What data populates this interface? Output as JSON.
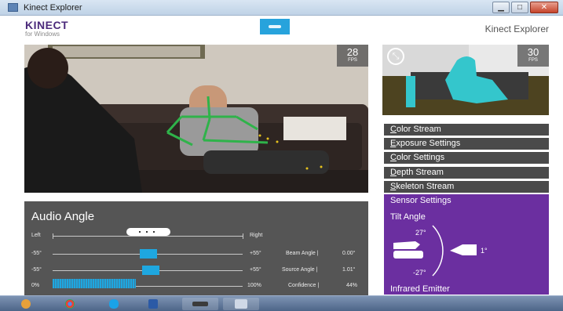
{
  "window": {
    "title": "Kinect Explorer",
    "min_glyph": "▁",
    "max_glyph": "□",
    "close_glyph": "✕"
  },
  "header": {
    "logo_main": "KINECT",
    "logo_sub": "for Windows",
    "app_title": "Kinect Explorer",
    "center_icon": "kinect-sensor-icon"
  },
  "color_stream": {
    "fps": "28",
    "fps_unit": "FPS"
  },
  "depth_stream": {
    "fps": "30",
    "fps_unit": "FPS",
    "icon": "expand-arrows-icon",
    "icon_glyph": "⤡"
  },
  "nav": {
    "items": [
      {
        "label": "Color Stream"
      },
      {
        "label": "Exposure Settings"
      },
      {
        "label": "Color Settings"
      },
      {
        "label": "Depth Stream"
      },
      {
        "label": "Skeleton Stream"
      }
    ]
  },
  "sensor_settings": {
    "header": "Sensor Settings",
    "tilt_label": "Tilt Angle",
    "max_angle": "27°",
    "min_angle": "-27°",
    "current_angle": "1°",
    "infrared_label": "Infrared Emitter"
  },
  "audio": {
    "title": "Audio Angle",
    "left_label": "Left",
    "right_label": "Right",
    "beam": {
      "min": "-55°",
      "max": "+55°",
      "label": "Beam Angle |",
      "value": "0.00°"
    },
    "source": {
      "min": "-55°",
      "max": "+55°",
      "label": "Source Angle |",
      "value": "1.01°"
    },
    "confidence": {
      "min": "0%",
      "max": "100%",
      "label": "Confidence |",
      "value": "44%",
      "level": 0.44
    }
  },
  "taskbar": {
    "items": [
      "start-orb-icon",
      "chrome-icon",
      "skype-icon",
      "word-icon",
      "kinect-explorer-icon",
      "kinect-studio-icon"
    ]
  },
  "colors": {
    "accent_purple": "#6b2fa0",
    "accent_blue": "#1ea7e0",
    "panel_gray": "#555555",
    "nav_gray": "#4a4a4a"
  }
}
